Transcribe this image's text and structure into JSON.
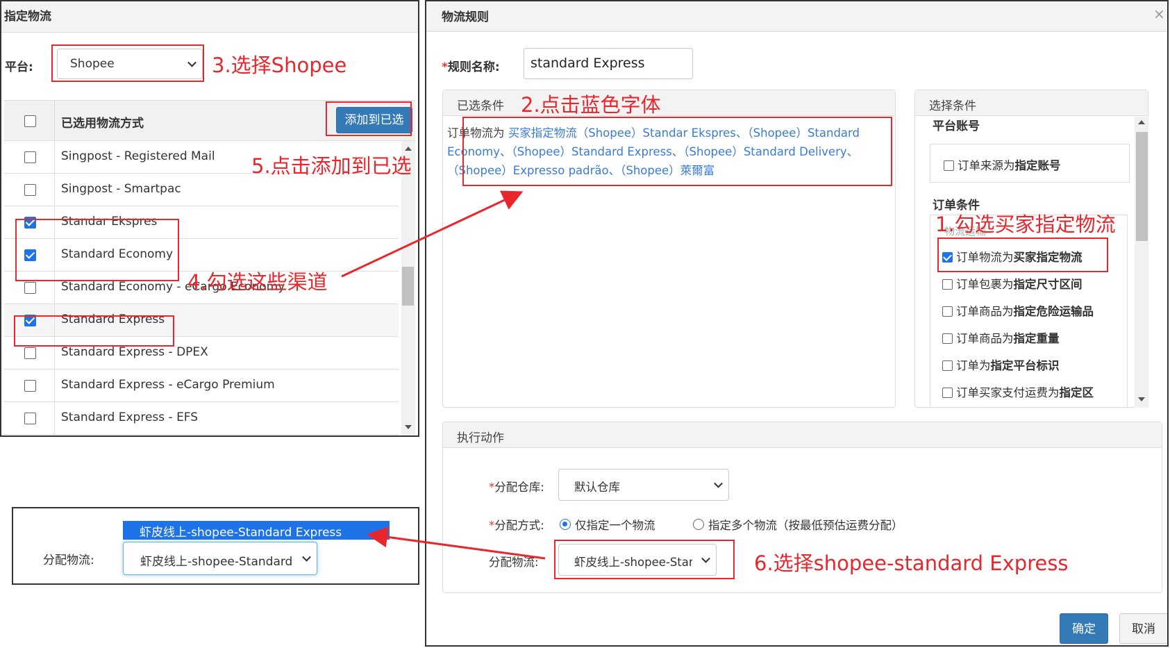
{
  "left_panel": {
    "title": "指定物流",
    "platform_label": "平台:",
    "platform_value": "Shopee",
    "list_header": "已选用物流方式",
    "add_button": "添加到已选",
    "rows": [
      {
        "label": "Singpost - Registered Mail",
        "checked": false
      },
      {
        "label": "Singpost - Smartpac",
        "checked": false
      },
      {
        "label": "Standar Ekspres",
        "checked": true
      },
      {
        "label": "Standard Economy",
        "checked": true
      },
      {
        "label": "Standard Economy - eCargo Economy",
        "checked": false
      },
      {
        "label": "Standard Express",
        "checked": true
      },
      {
        "label": "Standard Express - DPEX",
        "checked": false
      },
      {
        "label": "Standard Express - eCargo Premium",
        "checked": false
      },
      {
        "label": "Standard Express - EFS",
        "checked": false
      }
    ]
  },
  "assign_panel": {
    "label": "分配物流:",
    "select_value": "虾皮线上-shopee-Standard Express",
    "highlighted_option": "虾皮线上-shopee-Standard Express"
  },
  "right_panel": {
    "title": "物流规则",
    "close": "×",
    "rule_name_label": "规则名称:",
    "rule_name_value": "standard Express",
    "selected_conditions": {
      "header": "已选条件",
      "prefix": "订单物流为 ",
      "link_text": "买家指定物流（Shopee）Standar Ekspres、（Shopee）Standard Economy、（Shopee）Standard Express、（Shopee）Standard Delivery、（Shopee）Expresso padrão、（Shopee）萊爾富"
    },
    "choose_conditions": {
      "header": "选择条件",
      "platform_account_title": "平台账号",
      "account_condition_prefix": "订单来源为",
      "account_condition_bold": "指定账号",
      "order_conditions_title": "订单条件",
      "logistics_legend": "物流运输",
      "conditions": [
        {
          "prefix": "订单物流为",
          "bold": "买家指定物流",
          "checked": true
        },
        {
          "prefix": "订单包裹为",
          "bold": "指定尺寸区间",
          "checked": false
        },
        {
          "prefix": "订单商品为",
          "bold": "指定危险运输品",
          "checked": false
        },
        {
          "prefix": "订单商品为",
          "bold": "指定重量",
          "checked": false
        },
        {
          "prefix": "订单为",
          "bold": "指定平台标识",
          "checked": false
        },
        {
          "prefix": "订单买家支付运费为",
          "bold": "指定区",
          "checked": false
        }
      ]
    },
    "actions": {
      "header": "执行动作",
      "warehouse_label": "分配仓库:",
      "warehouse_value": "默认仓库",
      "method_label": "分配方式:",
      "method_single": "仅指定一个物流",
      "method_multi": "指定多个物流（按最低预估运费分配）",
      "logistics_label": "分配物流:",
      "logistics_value": "虾皮线上-shopee-Standard Express"
    },
    "confirm_button": "确定",
    "cancel_button": "取消"
  },
  "annotations": {
    "step1": "1.勾选买家指定物流",
    "step2": "2.点击蓝色字体",
    "step3": "3.选择Shopee",
    "step4": "4.勾选这些渠道",
    "step5": "5.点击添加到已选",
    "step6": "6.选择shopee-standard Express",
    "color": "#e8262b"
  },
  "colors": {
    "primary": "#337ab7",
    "link": "#3a7bd5",
    "checkbox_checked": "#1e73e8"
  }
}
